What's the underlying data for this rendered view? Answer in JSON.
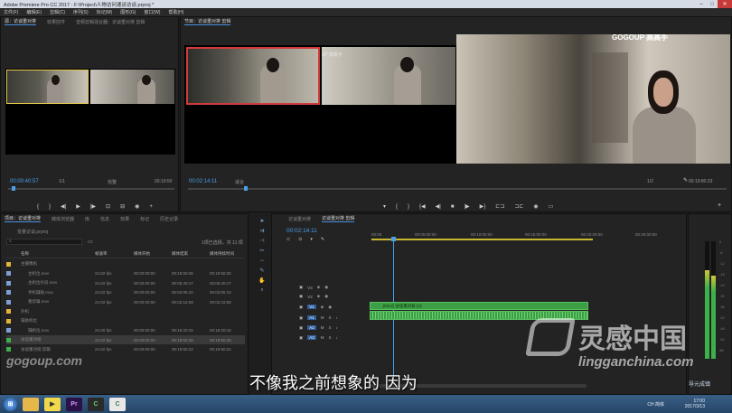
{
  "window": {
    "title": "Adobe Premiere Pro CC 2017 - F:\\Project\\人物访问速谈访谈.prproj *"
  },
  "menu": [
    "文件(F)",
    "编辑(E)",
    "剪辑(C)",
    "序列(S)",
    "标记(M)",
    "图形(G)",
    "窗口(W)",
    "帮助(H)"
  ],
  "source_monitor": {
    "tabs": [
      "源：访谈重对排",
      "效果控件",
      "音频剪辑混合器：访谈重对排 剪辑"
    ],
    "timecode": "00:00:40:57",
    "fit": "适合",
    "fraction": "1/1",
    "full": "完整",
    "duration": "00:19:50"
  },
  "program_monitor": {
    "tab": "节目：访谈重对排 剪辑",
    "timecode": "00:02:14:11",
    "fit": "适合",
    "fraction": "1/2",
    "duration": "00:19:80:23",
    "watermark": "GOGOUP 高高手"
  },
  "project": {
    "tabs": [
      "项目：访谈重对排",
      "媒体浏览器",
      "库",
      "信息",
      "效果",
      "标记",
      "历史记录"
    ],
    "search_placeholder": "变量访谈.prproj",
    "count": "1项已选择，共 11 项",
    "columns": [
      "名称",
      "帧速率",
      "媒体开始",
      "媒体结束",
      "媒体持续时间"
    ],
    "rows": [
      {
        "name": "主摄像机",
        "fps": "",
        "start": "",
        "end": "",
        "dur": "",
        "color": "#e5b33a",
        "indent": 1
      },
      {
        "name": "主机位.mov",
        "fps": "24.02 fps",
        "start": "00:00:00:00",
        "end": "00:19:50:26",
        "dur": "00:19:50:26",
        "color": "#7c9fd4",
        "indent": 2
      },
      {
        "name": "主机位片段.mov",
        "fps": "24.02 fps",
        "start": "00:00:00:00",
        "end": "00:05:40:17",
        "dur": "00:05:40:17",
        "color": "#7c9fd4",
        "indent": 2
      },
      {
        "name": "手机辅助.mov",
        "fps": "24.02 fps",
        "start": "00:00:00:00",
        "end": "00:03:05:10",
        "dur": "00:03:05:10",
        "color": "#7c9fd4",
        "indent": 2
      },
      {
        "name": "重剪辑.mov",
        "fps": "24.02 fps",
        "start": "00:00:00:00",
        "end": "00:02:16:58",
        "dur": "00:02:16:58",
        "color": "#7c9fd4",
        "indent": 2
      },
      {
        "name": "外机",
        "fps": "",
        "start": "",
        "end": "",
        "dur": "",
        "color": "#e5b33a",
        "indent": 1
      },
      {
        "name": "辅助机位",
        "fps": "",
        "start": "",
        "end": "",
        "dur": "",
        "color": "#e5b33a",
        "indent": 1
      },
      {
        "name": "辅机位.mov",
        "fps": "24.00 fps",
        "start": "00:00:00:00",
        "end": "00:15:20:15",
        "dur": "00:15:20:15",
        "color": "#7c9fd4",
        "indent": 2
      },
      {
        "name": "访谈重对排",
        "fps": "24.02 fps",
        "start": "00:00:00:00",
        "end": "00:19:50:26",
        "dur": "00:19:50:26",
        "color": "#3cb04a",
        "indent": 1
      },
      {
        "name": "访谈重对排 剪辑",
        "fps": "24.02 fps",
        "start": "00:00:00:00",
        "end": "00:19:50:22",
        "dur": "00:19:50:22",
        "color": "#3cb04a",
        "indent": 1
      }
    ]
  },
  "timeline": {
    "tabs": [
      "访谈重对排",
      "访谈重对排 剪辑"
    ],
    "timecode": "00:02:14:11",
    "ruler": [
      "00:00",
      "00:05:00:00",
      "00:10:00:00",
      "00:15:00:00",
      "00:20:00:00",
      "00:25:00:00"
    ],
    "tracks": [
      "V3",
      "V2",
      "V1",
      "A1",
      "A2",
      "A3"
    ],
    "clip_label": "[MC2] 访谈重对排 [V]",
    "meter_scale": [
      "0",
      "-6",
      "-12",
      "-18",
      "-24",
      "-30",
      "-36",
      "-42",
      "-48",
      "-54",
      "dB"
    ]
  },
  "subtitle": "不像我之前想象的 因为",
  "watermarks": {
    "site1": "gogoup.com",
    "site2": "lingganchina.com",
    "brand": "灵感中国",
    "corner": "导元成镇"
  },
  "taskbar": {
    "time": "17:00",
    "date": "2017/3/13",
    "lang": "CH 简体"
  },
  "colors": {
    "accent": "#4a9fe8",
    "clip": "#3c9e45",
    "selection": "#e5c74a",
    "active_frame": "#d23a3a"
  }
}
